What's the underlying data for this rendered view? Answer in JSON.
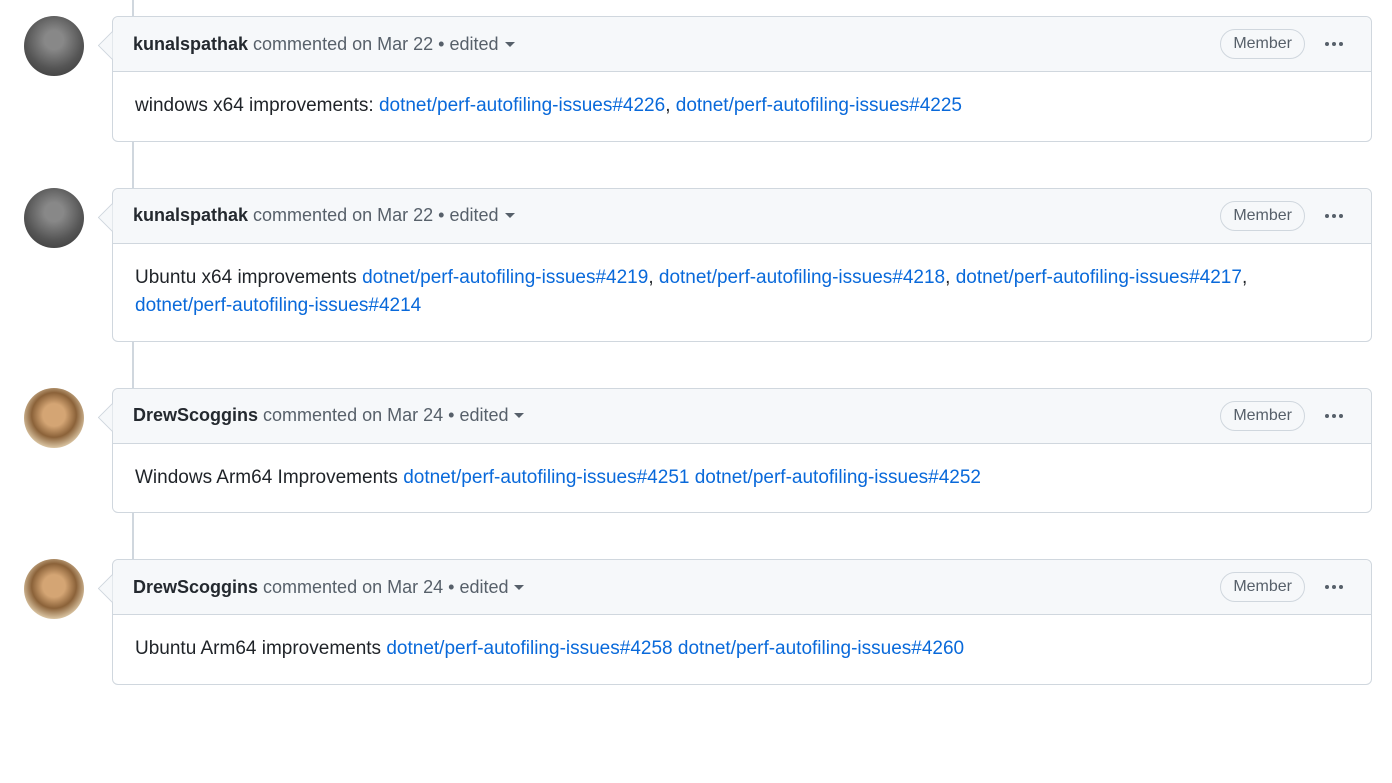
{
  "labels": {
    "member": "Member",
    "commented": "commented",
    "on": "on",
    "edited": "edited"
  },
  "comments": [
    {
      "author": "kunalspathak",
      "date": "Mar 22",
      "edited": true,
      "avatar": "avatar-1",
      "body_prefix": "windows x64 improvements: ",
      "links": [
        {
          "text": "dotnet/perf-autofiling-issues#4226",
          "sep": ", "
        },
        {
          "text": "dotnet/perf-autofiling-issues#4225",
          "sep": ""
        }
      ]
    },
    {
      "author": "kunalspathak",
      "date": "Mar 22",
      "edited": true,
      "avatar": "avatar-1",
      "body_prefix": "Ubuntu x64 improvements ",
      "links": [
        {
          "text": "dotnet/perf-autofiling-issues#4219",
          "sep": ", "
        },
        {
          "text": "dotnet/perf-autofiling-issues#4218",
          "sep": ", "
        },
        {
          "text": "dotnet/perf-autofiling-issues#4217",
          "sep": ", "
        },
        {
          "text": "dotnet/perf-autofiling-issues#4214",
          "sep": ""
        }
      ]
    },
    {
      "author": "DrewScoggins",
      "date": "Mar 24",
      "edited": true,
      "avatar": "avatar-2",
      "body_prefix": "Windows Arm64 Improvements ",
      "links": [
        {
          "text": "dotnet/perf-autofiling-issues#4251",
          "sep": " "
        },
        {
          "text": "dotnet/perf-autofiling-issues#4252",
          "sep": ""
        }
      ]
    },
    {
      "author": "DrewScoggins",
      "date": "Mar 24",
      "edited": true,
      "avatar": "avatar-2",
      "body_prefix": "Ubuntu Arm64 improvements ",
      "links": [
        {
          "text": "dotnet/perf-autofiling-issues#4258",
          "sep": " "
        },
        {
          "text": "dotnet/perf-autofiling-issues#4260",
          "sep": ""
        }
      ]
    }
  ]
}
